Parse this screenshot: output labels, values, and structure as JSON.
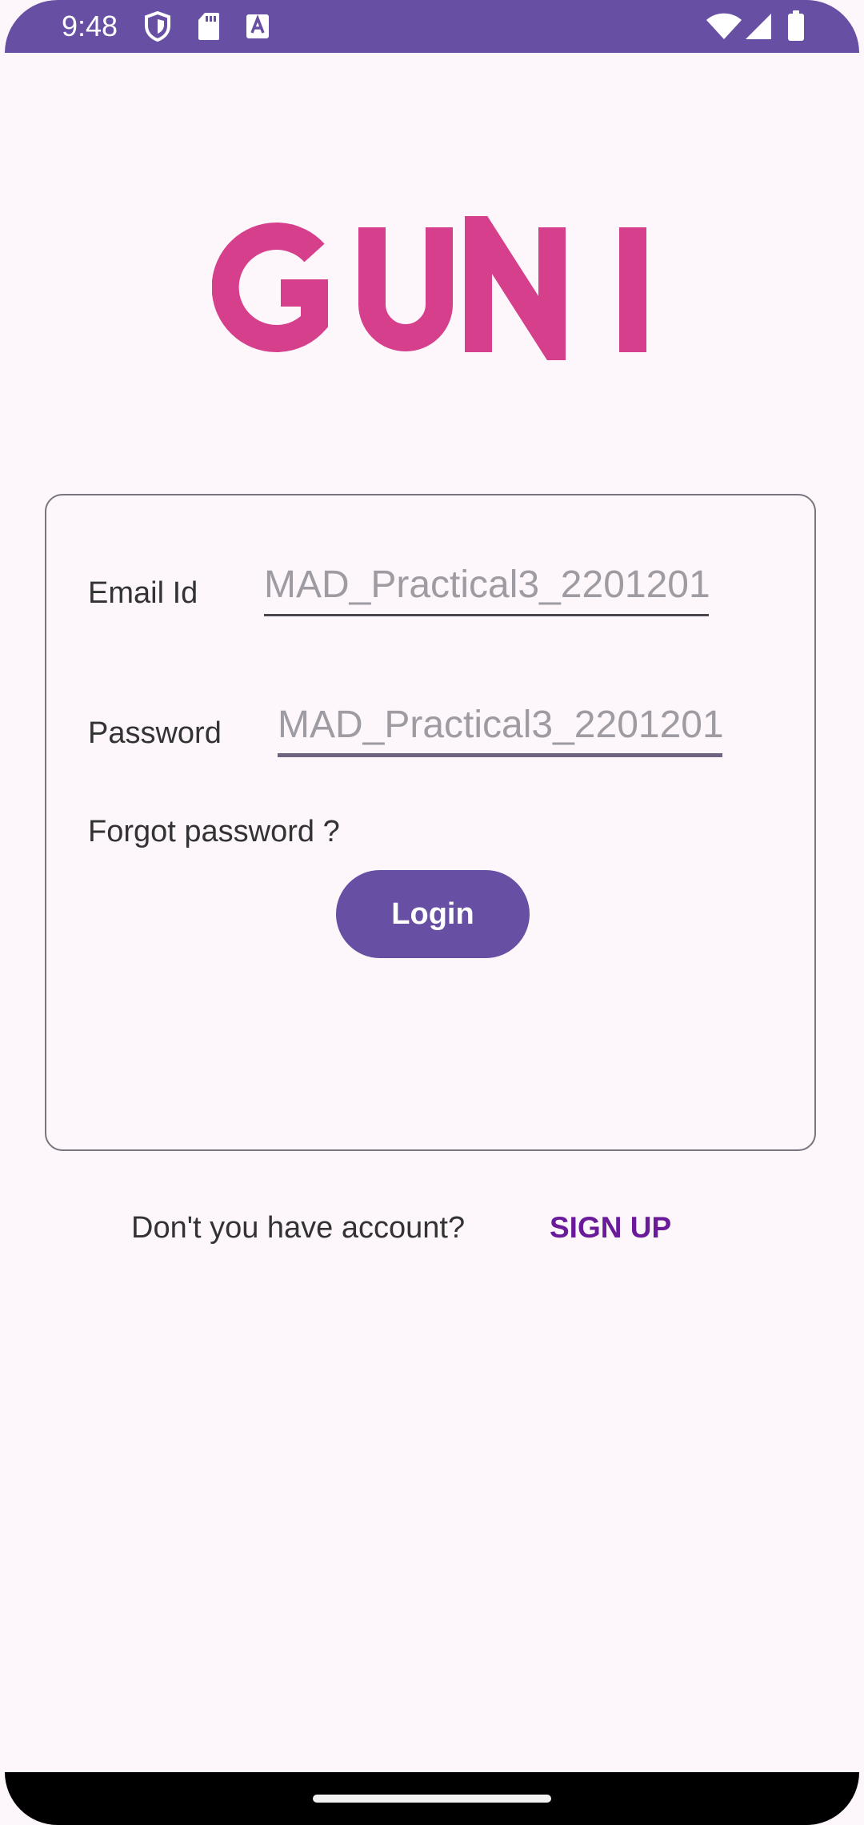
{
  "status_bar": {
    "time": "9:48",
    "left_icons": [
      "shield-icon",
      "sd-card-icon",
      "text-a-icon"
    ],
    "right_icons": [
      "wifi-icon",
      "cellular-signal-icon",
      "battery-icon"
    ]
  },
  "logo": {
    "text": "GUNI",
    "color": "#d63f8c"
  },
  "login_form": {
    "email": {
      "label": "Email Id",
      "placeholder": "MAD_Practical3_2201201",
      "value": ""
    },
    "password": {
      "label": "Password",
      "placeholder": "MAD_Practical3_2201201",
      "value": ""
    },
    "forgot_password": "Forgot password ?",
    "login_button": "Login"
  },
  "footer": {
    "prompt": "Don't you have account?",
    "sign_up": "SIGN UP"
  },
  "colors": {
    "primary": "#6750a4",
    "logo": "#d63f8c",
    "sign_up": "#6a1b9a",
    "background": "#fdf7fb"
  }
}
